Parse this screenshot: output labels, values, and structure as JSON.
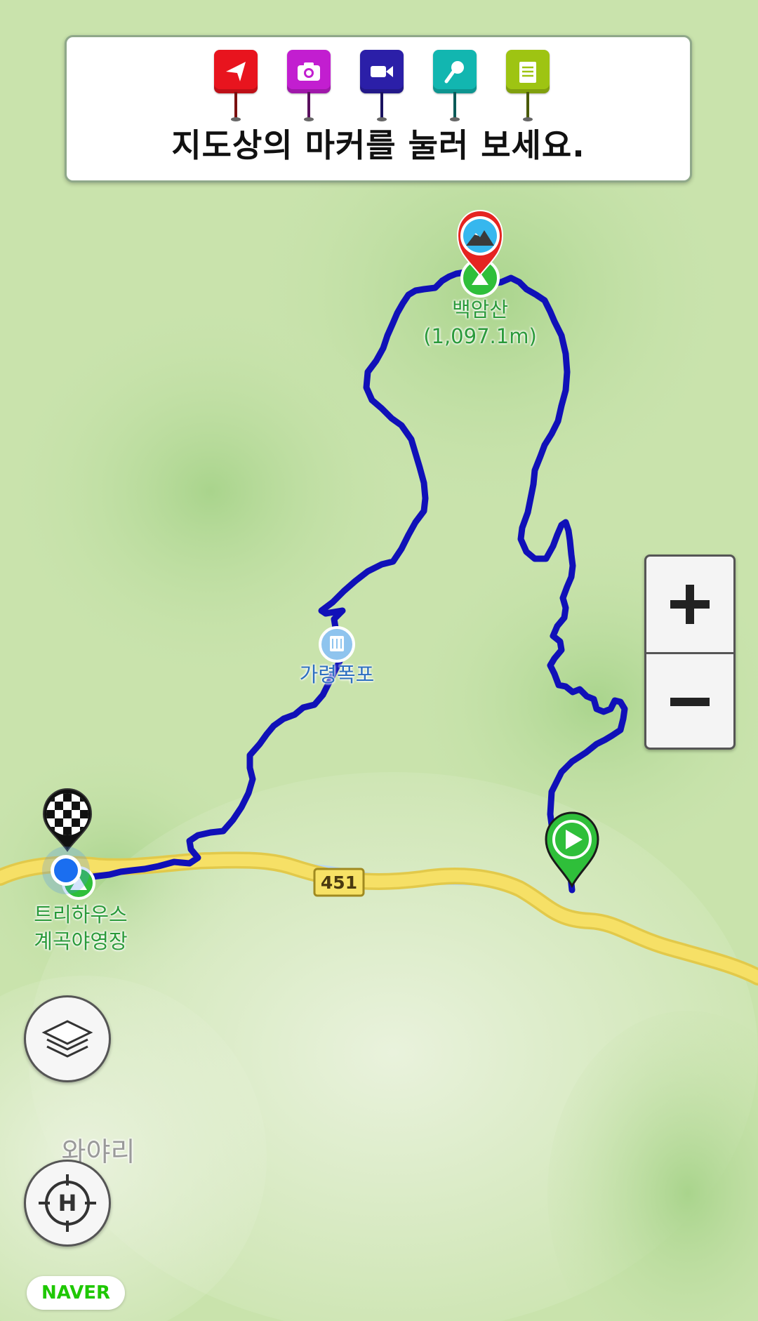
{
  "legend": {
    "instruction": "지도상의 마커를 눌러 보세요.",
    "markers": [
      {
        "name": "direction-marker",
        "color": "#e8141e",
        "icon": "arrow-icon"
      },
      {
        "name": "photo-marker",
        "color": "#c21ed0",
        "icon": "camera-icon"
      },
      {
        "name": "video-marker",
        "color": "#2b1fa8",
        "icon": "video-icon"
      },
      {
        "name": "audio-marker",
        "color": "#12b6b0",
        "icon": "microphone-icon"
      },
      {
        "name": "memo-marker",
        "color": "#9ec412",
        "icon": "notepad-icon"
      }
    ]
  },
  "map": {
    "peak_name": "백암산",
    "peak_elevation": "(1,097.1m)",
    "waterfall_name": "가령폭포",
    "campsite_name_line1": "트리하우스",
    "campsite_name_line2": "계곡야영장",
    "village_name": "와야리",
    "road_number": "451",
    "route_color": "#1010b8",
    "road_color": "#f5df5e"
  },
  "controls": {
    "zoom_in_icon": "plus-icon",
    "zoom_out_icon": "minus-icon",
    "layers_icon": "layers-icon",
    "locate_icon": "crosshair-h-icon"
  },
  "attribution": "NAVER"
}
